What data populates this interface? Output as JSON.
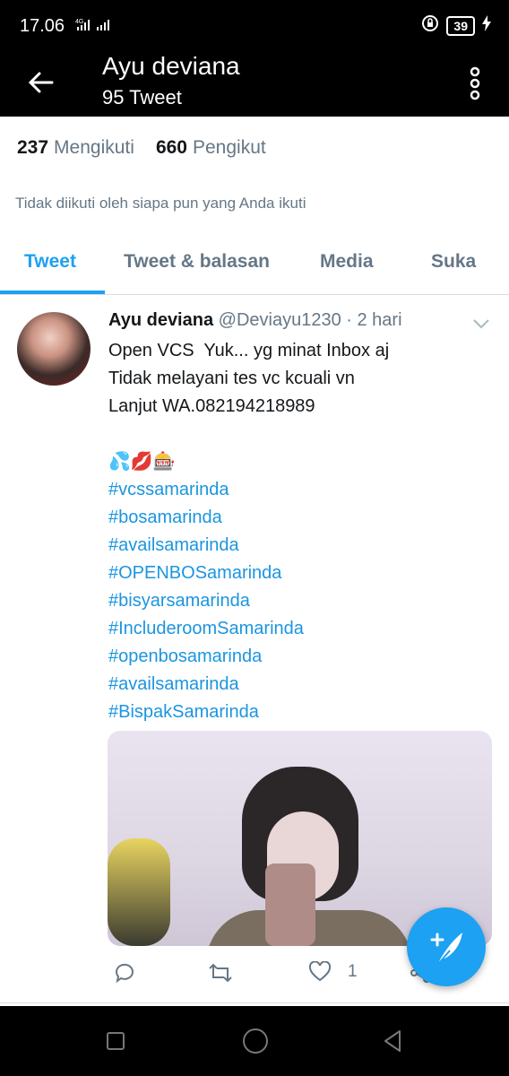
{
  "status": {
    "time": "17.06",
    "network": "4G",
    "battery": "39"
  },
  "header": {
    "name": "Ayu deviana",
    "tweet_count": "95 Tweet"
  },
  "profile": {
    "following_count": "237",
    "following_label": "Mengikuti",
    "followers_count": "660",
    "followers_label": "Pengikut",
    "followed_by": "Tidak diikuti oleh siapa pun yang Anda ikuti"
  },
  "tabs": [
    "Tweet",
    "Tweet & balasan",
    "Media",
    "Suka"
  ],
  "tweet": {
    "name": "Ayu deviana",
    "meta": "@Deviayu1230 · 2 hari",
    "lines": [
      "Open VCS  Yuk... yg minat Inbox aj",
      "Tidak melayani tes vc kcuali vn",
      "Lanjut WA.082194218989",
      "",
      "💦💋🎰"
    ],
    "hashtags": [
      "#vcssamarinda",
      "#bosamarinda",
      "#availsamarinda",
      "#OPENBOSamarinda",
      "#bisyarsamarinda",
      "#IncluderoomSamarinda",
      "#openbosamarinda",
      "#availsamarinda",
      "#BispakSamarinda"
    ],
    "like_count": "1"
  },
  "colors": {
    "accent": "#1da1f2",
    "link": "#1b95e0",
    "muted": "#657786",
    "bar": "#000000"
  }
}
